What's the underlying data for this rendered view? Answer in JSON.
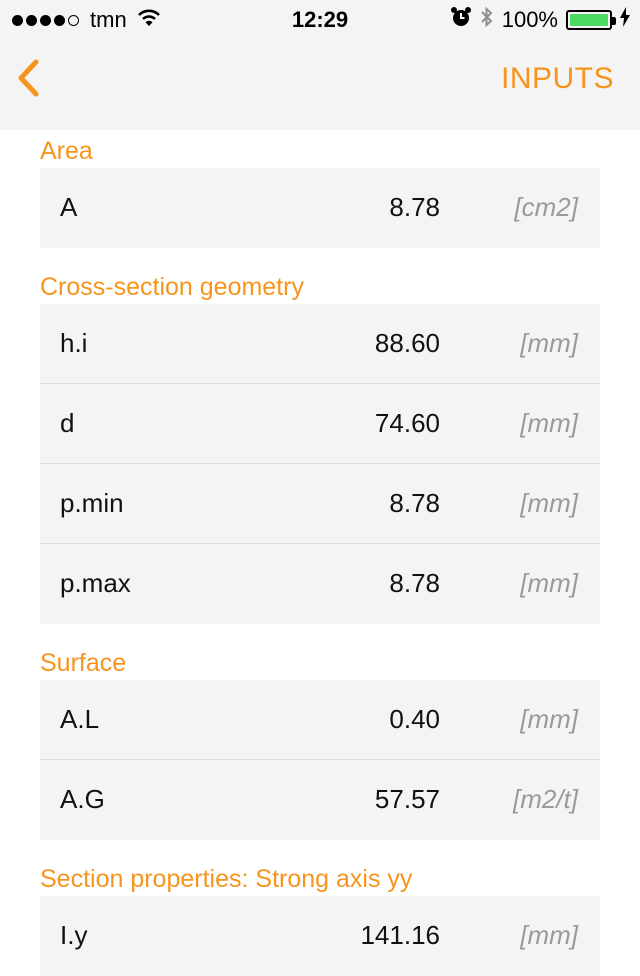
{
  "status_bar": {
    "carrier": "tmn",
    "time": "12:29",
    "battery": "100%",
    "signal_bars_filled": 4,
    "signal_bars_total": 5
  },
  "nav": {
    "title": "INPUTS",
    "back_icon": "chevron-left-icon",
    "accent_color": "#f7941d"
  },
  "sections": [
    {
      "title": "Area",
      "rows": [
        {
          "label": "A",
          "value": "8.78",
          "unit": "[cm2]"
        }
      ]
    },
    {
      "title": "Cross-section geometry",
      "rows": [
        {
          "label": "h.i",
          "value": "88.60",
          "unit": "[mm]"
        },
        {
          "label": "d",
          "value": "74.60",
          "unit": "[mm]"
        },
        {
          "label": "p.min",
          "value": "8.78",
          "unit": "[mm]"
        },
        {
          "label": "p.max",
          "value": "8.78",
          "unit": "[mm]"
        }
      ]
    },
    {
      "title": "Surface",
      "rows": [
        {
          "label": "A.L",
          "value": "0.40",
          "unit": "[mm]"
        },
        {
          "label": "A.G",
          "value": "57.57",
          "unit": "[m2/t]"
        }
      ]
    },
    {
      "title": "Section properties: Strong axis yy",
      "rows": [
        {
          "label": "I.y",
          "value": "141.16",
          "unit": "[mm]"
        }
      ]
    }
  ]
}
